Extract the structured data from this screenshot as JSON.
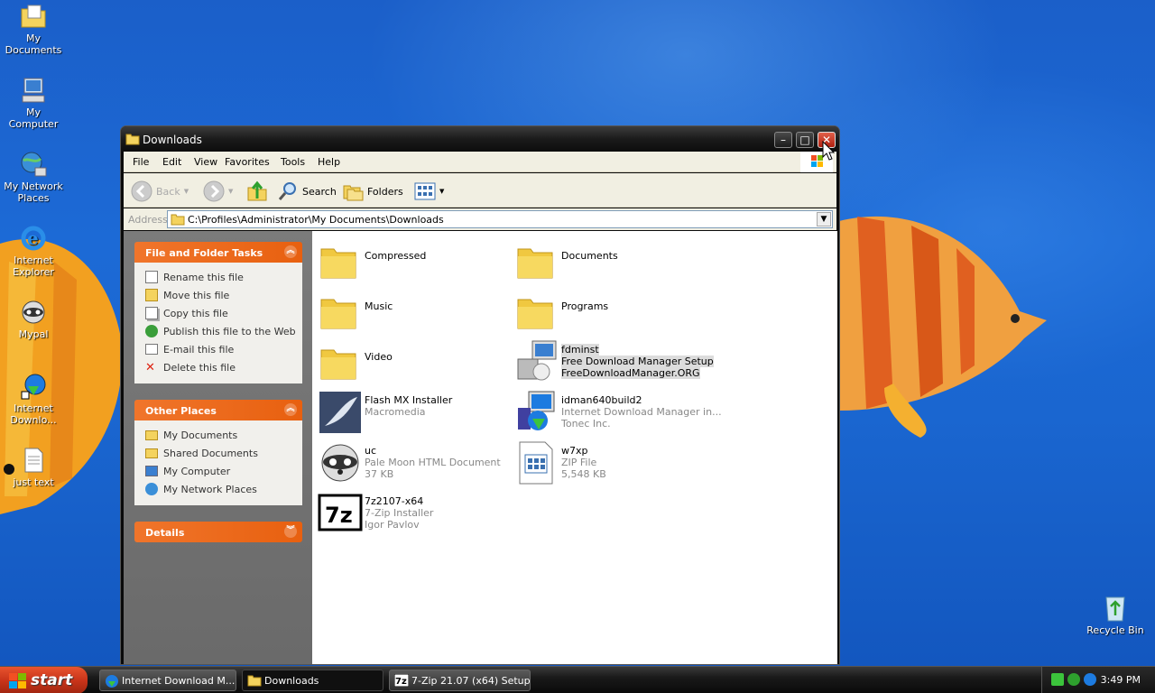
{
  "desktop": {
    "icons": [
      {
        "label": "My Documents",
        "icon": "my-documents-icon"
      },
      {
        "label": "My Computer",
        "icon": "my-computer-icon"
      },
      {
        "label": "My Network Places",
        "icon": "network-places-icon"
      },
      {
        "label": "Internet Explorer",
        "icon": "internet-explorer-icon"
      },
      {
        "label": "Mypal",
        "icon": "mypal-icon"
      },
      {
        "label": "Internet Downlo...",
        "icon": "idm-icon"
      },
      {
        "label": "just text",
        "icon": "text-file-icon"
      },
      {
        "label": "Recycle Bin",
        "icon": "recycle-bin-icon"
      }
    ]
  },
  "window": {
    "title": "Downloads",
    "menu": [
      "File",
      "Edit",
      "View",
      "Favorites",
      "Tools",
      "Help"
    ],
    "toolbar": {
      "back": "Back",
      "search": "Search",
      "folders": "Folders"
    },
    "address": {
      "label": "Address",
      "path": "C:\\Profiles\\Administrator\\My Documents\\Downloads"
    },
    "tasks_panel": {
      "title": "File and Folder Tasks",
      "items": [
        "Rename this file",
        "Move this file",
        "Copy this file",
        "Publish this file to the Web",
        "E-mail this file",
        "Delete this file"
      ]
    },
    "places_panel": {
      "title": "Other Places",
      "items": [
        "My Documents",
        "Shared Documents",
        "My Computer",
        "My Network Places"
      ]
    },
    "details_panel": {
      "title": "Details"
    },
    "files": [
      {
        "name": "Compressed"
      },
      {
        "name": "Documents"
      },
      {
        "name": "Music"
      },
      {
        "name": "Programs"
      },
      {
        "name": "Video"
      },
      {
        "l1": "fdminst",
        "l2": "Free Download Manager Setup",
        "l3": "FreeDownloadManager.ORG"
      },
      {
        "l1": "Flash MX Installer",
        "l2": "Macromedia"
      },
      {
        "l1": "idman640build2",
        "l2": "Internet Download Manager in...",
        "l3": "Tonec Inc."
      },
      {
        "l1": "uc",
        "l2": "Pale Moon HTML Document",
        "l3": "37 KB"
      },
      {
        "l1": "w7xp",
        "l2": "ZIP File",
        "l3": "5,548 KB"
      },
      {
        "l1": "7z2107-x64",
        "l2": "7-Zip Installer",
        "l3": "Igor Pavlov"
      }
    ]
  },
  "taskbar": {
    "start": "start",
    "tasks": [
      "Internet Download M...",
      "Downloads",
      "7-Zip 21.07 (x64) Setup"
    ],
    "clock": "3:49 PM"
  }
}
